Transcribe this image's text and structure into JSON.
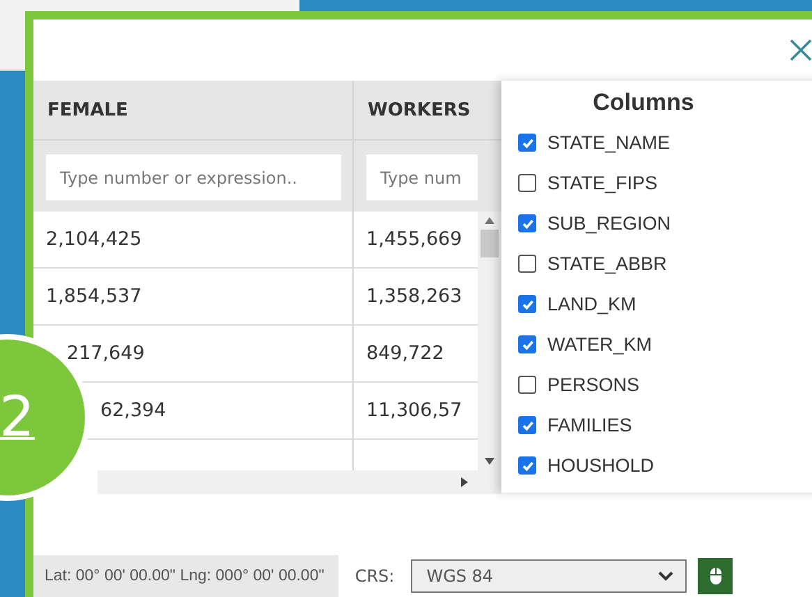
{
  "badge": {
    "label": "2"
  },
  "table": {
    "columns": [
      {
        "label": "FEMALE",
        "filter_placeholder": "Type number or expression.."
      },
      {
        "label": "WORKERS",
        "filter_placeholder": "Type num"
      }
    ],
    "rows": [
      {
        "kind": "clear",
        "cells": [
          "2,104,425",
          "1,455,669"
        ]
      },
      {
        "kind": "clear",
        "cells": [
          "1,854,537",
          "1,358,263"
        ]
      },
      {
        "kind": "edge_hidden",
        "cells": [
          "217,649",
          "849,722"
        ]
      },
      {
        "kind": "half_hidden",
        "cells": [
          "62,394",
          "11,306,57"
        ]
      }
    ]
  },
  "columns_panel": {
    "title": "Columns",
    "items": [
      {
        "label": "STATE_NAME",
        "checked": true
      },
      {
        "label": "STATE_FIPS",
        "checked": false
      },
      {
        "label": "SUB_REGION",
        "checked": true
      },
      {
        "label": "STATE_ABBR",
        "checked": false
      },
      {
        "label": "LAND_KM",
        "checked": true
      },
      {
        "label": "WATER_KM",
        "checked": true
      },
      {
        "label": "PERSONS",
        "checked": false
      },
      {
        "label": "FAMILIES",
        "checked": true
      },
      {
        "label": "HOUSHOLD",
        "checked": true
      }
    ]
  },
  "status_bar": {
    "coordinates": "Lat: 00° 00' 00.00\" Lng: 000° 00' 00.00\"",
    "crs_label": "CRS:",
    "crs_value": "WGS 84"
  }
}
